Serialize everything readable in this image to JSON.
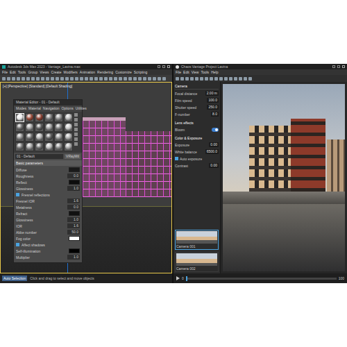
{
  "max": {
    "title": "Autodesk 3ds Max 2023 - Vantage_Lavina.max",
    "menu": [
      "File",
      "Edit",
      "Tools",
      "Group",
      "Views",
      "Create",
      "Modifiers",
      "Animation",
      "Rendering",
      "Customize",
      "Scripting"
    ],
    "viewport_label": "[+] [Perspective] [Standard] [Default Shading]",
    "status_left": "Auto Selection",
    "status": "Click and drag to select and move objects"
  },
  "material_editor": {
    "title": "Material Editor - 01 - Default",
    "menu": [
      "Modes",
      "Material",
      "Navigation",
      "Options",
      "Utilities"
    ],
    "slots": [
      {
        "color": "#e8e8e8",
        "selected": true
      },
      {
        "color": "#9a4a38",
        "selected": false
      },
      {
        "color": "#8a3f30",
        "selected": false
      },
      {
        "color": "#7c7c7c",
        "selected": false
      },
      {
        "color": "#8e8e8e",
        "selected": false
      },
      {
        "color": "#b5b5b5",
        "selected": false
      },
      {
        "color": "#6a6a6a",
        "selected": false
      },
      {
        "color": "#a0a0a0",
        "selected": false
      },
      {
        "color": "#5a5a5a",
        "selected": false
      },
      {
        "color": "#9c9c9c",
        "selected": false
      },
      {
        "color": "#7a7a7a",
        "selected": false
      },
      {
        "color": "#c4c4c4",
        "selected": false
      },
      {
        "color": "#8c8c8c",
        "selected": false
      },
      {
        "color": "#6e6e6e",
        "selected": false
      },
      {
        "color": "#b0b0b0",
        "selected": false
      },
      {
        "color": "#5e5e5e",
        "selected": false
      },
      {
        "color": "#929292",
        "selected": false
      },
      {
        "color": "#a8a8a8",
        "selected": false
      },
      {
        "color": "#767676",
        "selected": false
      },
      {
        "color": "#9e9e9e",
        "selected": false
      },
      {
        "color": "#686868",
        "selected": false
      },
      {
        "color": "#b8b8b8",
        "selected": false
      },
      {
        "color": "#848484",
        "selected": false
      },
      {
        "color": "#a4a4a4",
        "selected": false
      }
    ],
    "material_name": "01 - Default",
    "material_type": "VRayMtl",
    "section": "Basic parameters",
    "rows": [
      {
        "kind": "swatch",
        "label": "Diffuse",
        "color": "#1a1a1a"
      },
      {
        "kind": "number",
        "label": "Roughness",
        "value": "0.0"
      },
      {
        "kind": "swatch",
        "label": "Reflect",
        "color": "#0d0d0d"
      },
      {
        "kind": "number",
        "label": "Glossiness",
        "value": "1.0"
      },
      {
        "kind": "check",
        "label": "Fresnel reflections",
        "checked": true
      },
      {
        "kind": "number",
        "label": "Fresnel IOR",
        "value": "1.6"
      },
      {
        "kind": "number",
        "label": "Metalness",
        "value": "0.0"
      },
      {
        "kind": "swatch",
        "label": "Refract",
        "color": "#111111"
      },
      {
        "kind": "number",
        "label": "Glossiness",
        "value": "1.0"
      },
      {
        "kind": "number",
        "label": "IOR",
        "value": "1.6"
      },
      {
        "kind": "number",
        "label": "Abbe number",
        "value": "50.0"
      },
      {
        "kind": "swatch",
        "label": "Fog color",
        "color": "#ffffff"
      },
      {
        "kind": "check",
        "label": "Affect shadows",
        "checked": true
      },
      {
        "kind": "swatch",
        "label": "Self-illumination",
        "color": "#000000"
      },
      {
        "kind": "number",
        "label": "Multiplier",
        "value": "1.0"
      }
    ]
  },
  "vantage": {
    "title": "Chaos Vantage Project Lavina",
    "menu": [
      "File",
      "Edit",
      "View",
      "Tools",
      "Help"
    ],
    "panel_title": "Camera",
    "rows": [
      {
        "kind": "number",
        "label": "Focal distance",
        "value": "2.00 m"
      },
      {
        "kind": "number",
        "label": "Film speed",
        "value": "100.0"
      },
      {
        "kind": "number",
        "label": "Shutter speed",
        "value": "250.0"
      },
      {
        "kind": "number",
        "label": "F-number",
        "value": "8.0"
      },
      {
        "kind": "section",
        "label": "Lens effects"
      },
      {
        "kind": "toggle",
        "label": "Bloom",
        "on": true
      },
      {
        "kind": "section",
        "label": "Color & Exposure"
      },
      {
        "kind": "number",
        "label": "Exposure",
        "value": "0.00"
      },
      {
        "kind": "number",
        "label": "White balance",
        "value": "6500.0"
      },
      {
        "kind": "check",
        "label": "Auto exposure",
        "checked": true
      },
      {
        "kind": "number",
        "label": "Contrast",
        "value": "0.00"
      }
    ],
    "thumbnails": [
      {
        "label": "Camera 001",
        "selected": true
      },
      {
        "label": "Camera 002",
        "selected": false
      }
    ],
    "timeline": {
      "start": "0",
      "end": "100",
      "level": 0.0
    }
  }
}
